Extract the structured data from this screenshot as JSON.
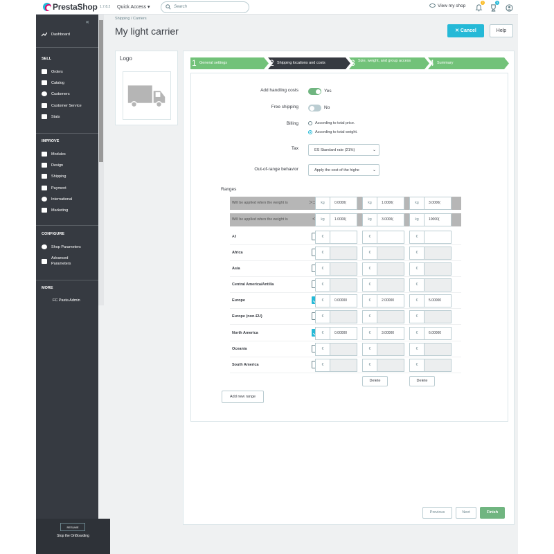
{
  "header": {
    "logo_text": "PrestaShop",
    "version": "1.7.8.2",
    "quick_access": "Quick Access",
    "search_placeholder": "Search",
    "view_shop": "View my shop",
    "notif_badge_1": "3",
    "notif_badge_2": "5"
  },
  "sidebar": {
    "dashboard": "Dashboard",
    "sec_sell": "SELL",
    "orders": "Orders",
    "catalog": "Catalog",
    "customers": "Customers",
    "customer_service": "Customer Service",
    "stats": "Stats",
    "sec_improve": "IMPROVE",
    "modules": "Modules",
    "design": "Design",
    "shipping": "Shipping",
    "payment": "Payment",
    "international": "International",
    "marketing": "Marketing",
    "sec_configure": "CONFIGURE",
    "shop_parameters": "Shop Parameters",
    "advanced_parameters_1": "Advanced",
    "advanced_parameters_2": "Parameters",
    "sec_more": "MORE",
    "module_item": "FC Pasta Admin",
    "resume": "RESUME",
    "stop_onboarding": "Stop the OnBoarding"
  },
  "breadcrumb": {
    "parent": "Shipping",
    "sep": "/",
    "current": "Carriers"
  },
  "page_title": "My light carrier",
  "buttons": {
    "cancel": "Cancel",
    "help": "Help",
    "previous": "Previous",
    "next": "Next",
    "finish": "Finish",
    "add_range": "Add new range",
    "delete": "Delete"
  },
  "logo_panel": {
    "title": "Logo"
  },
  "steps": [
    {
      "num": "1",
      "label": "General settings"
    },
    {
      "num": "2",
      "label": "Shipping locations and costs"
    },
    {
      "num": "3",
      "label": "Size, weight, and group access"
    },
    {
      "num": "4",
      "label": "Summary"
    }
  ],
  "form": {
    "handling_label": "Add handling costs",
    "handling_value": "Yes",
    "free_label": "Free shipping",
    "free_value": "No",
    "billing_label": "Billing",
    "billing_opt1": "According to total price.",
    "billing_opt2": "According to total weight.",
    "tax_label": "Tax",
    "tax_value": "ES Standard rate (21%)",
    "oor_label": "Out-of-range behavior",
    "oor_value": "Apply the cost of the highe"
  },
  "ranges": {
    "title": "Ranges",
    "row_ge": "Will be applied when the weight is",
    "op_ge": ">=",
    "row_lt": "Will be applied when the weight is",
    "op_lt": "<",
    "unit": "kg",
    "currency": "€",
    "from": [
      "0.0000(",
      "1.0000(",
      "3.0000("
    ],
    "to": [
      "1.0000(",
      "3.0000(",
      "10000("
    ],
    "zones": [
      {
        "name": "All",
        "checked": false,
        "prices": [
          "",
          "",
          ""
        ]
      },
      {
        "name": "Africa",
        "checked": false,
        "prices": [
          "",
          "",
          ""
        ]
      },
      {
        "name": "Asia",
        "checked": false,
        "prices": [
          "",
          "",
          ""
        ]
      },
      {
        "name": "Central America/Antilla",
        "checked": false,
        "prices": [
          "",
          "",
          ""
        ]
      },
      {
        "name": "Europe",
        "checked": true,
        "prices": [
          "0.00000",
          "2.00000",
          "5.00000"
        ]
      },
      {
        "name": "Europe (non-EU)",
        "checked": false,
        "prices": [
          "",
          "",
          ""
        ]
      },
      {
        "name": "North America",
        "checked": true,
        "prices": [
          "0.00000",
          "3.00000",
          "6.00000"
        ]
      },
      {
        "name": "Oceania",
        "checked": false,
        "prices": [
          "",
          "",
          ""
        ]
      },
      {
        "name": "South America",
        "checked": false,
        "prices": [
          "",
          "",
          ""
        ]
      }
    ]
  },
  "colors": {
    "accent": "#25b9d7",
    "success": "#70b580",
    "sidebar": "#363a41"
  }
}
